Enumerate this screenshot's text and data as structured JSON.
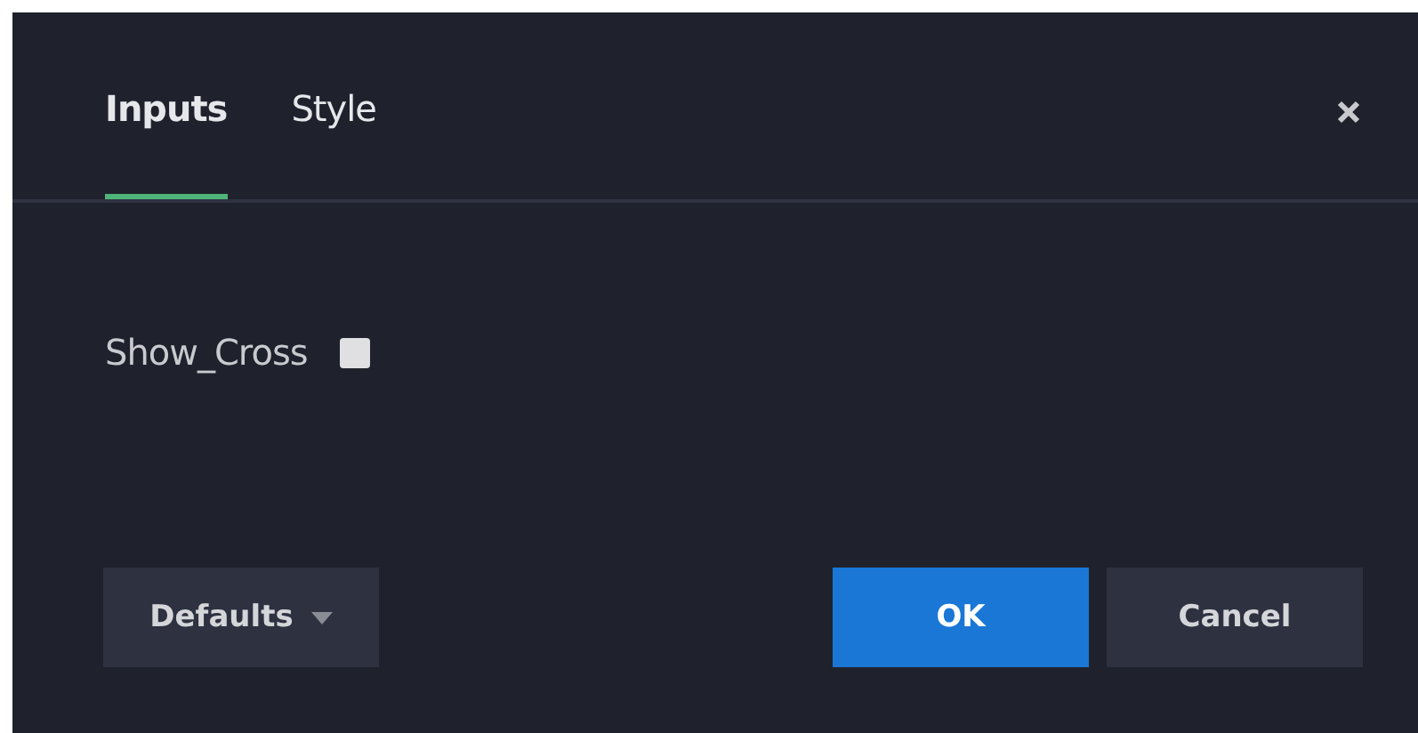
{
  "tabs": [
    {
      "label": "Inputs",
      "selected": true
    },
    {
      "label": "Style",
      "selected": false
    }
  ],
  "fields": [
    {
      "label": "Show_Cross",
      "checked": false
    }
  ],
  "buttons": {
    "defaults": "Defaults",
    "ok": "OK",
    "cancel": "Cancel"
  }
}
